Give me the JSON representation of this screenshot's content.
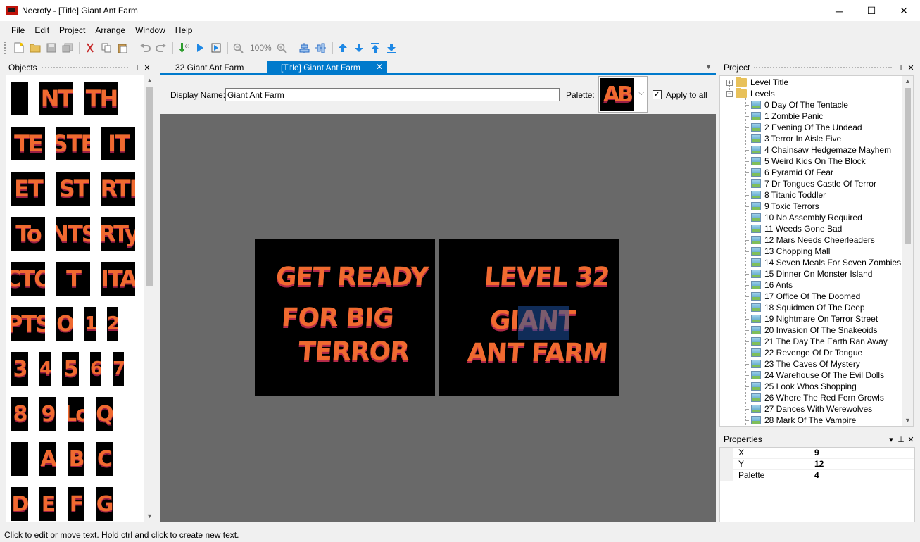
{
  "window": {
    "title": "Necrofy - [Title] Giant Ant Farm",
    "min": "─",
    "max": "☐",
    "close": "✕"
  },
  "menu": [
    "File",
    "Edit",
    "Project",
    "Arrange",
    "Window",
    "Help"
  ],
  "toolbar": {
    "zoom": "100%"
  },
  "objects_panel": {
    "title": "Objects",
    "pin": "📌",
    "close": "✕",
    "glyphs": [
      "",
      "NT",
      "TH",
      "TE",
      "STE",
      "IT",
      "ET",
      "ST",
      "RTI",
      "To",
      "NTS",
      "RTy",
      "CTO",
      "T",
      "ITA",
      "PTS",
      "O",
      "1",
      "2",
      "3",
      "4",
      "5",
      "6",
      "7",
      "8",
      "9",
      "Lo",
      "Q",
      "",
      "A",
      "B",
      "C",
      "D",
      "E",
      "F",
      "G"
    ]
  },
  "tabs": [
    {
      "label": "32 Giant Ant Farm",
      "active": false
    },
    {
      "label": "[Title] Giant Ant Farm",
      "active": true
    }
  ],
  "editor": {
    "display_name_label": "Display Name:",
    "display_name_value": "Giant Ant Farm",
    "palette_label": "Palette:",
    "palette_preview": "AB",
    "apply_all_label": "Apply to all",
    "apply_all_checked": true,
    "screen_left": [
      "GET  READY",
      "FOR BIG",
      "TERROR"
    ],
    "screen_right": [
      "LEVEL 32",
      "GIANT",
      "ANT  FARM"
    ]
  },
  "project_panel": {
    "title": "Project",
    "root_items": [
      "Level Title",
      "Levels"
    ],
    "levels": [
      "0 Day Of The Tentacle",
      "1 Zombie Panic",
      "2 Evening Of The Undead",
      "3 Terror In Aisle Five",
      "4 Chainsaw Hedgemaze Mayhem",
      "5 Weird Kids On The Block",
      "6 Pyramid Of Fear",
      "7 Dr Tongues Castle Of Terror",
      "8 Titanic Toddler",
      "9 Toxic Terrors",
      "10 No Assembly Required",
      "11 Weeds Gone Bad",
      "12 Mars Needs Cheerleaders",
      "13 Chopping Mall",
      "14 Seven Meals For Seven Zombies",
      "15 Dinner On Monster Island",
      "16 Ants",
      "17 Office Of The Doomed",
      "18 Squidmen Of The Deep",
      "19 Nightmare On Terror Street",
      "20 Invasion Of The Snakeoids",
      "21 The Day The Earth Ran Away",
      "22 Revenge Of Dr Tongue",
      "23 The Caves Of Mystery",
      "24 Warehouse Of The Evil Dolls",
      "25 Look Whos Shopping",
      "26 Where The Red Fern Growls",
      "27 Dances With Werewolves",
      "28 Mark Of The Vampire"
    ]
  },
  "properties": {
    "title": "Properties",
    "rows": [
      {
        "name": "X",
        "value": "9"
      },
      {
        "name": "Y",
        "value": "12"
      },
      {
        "name": "Palette",
        "value": "4"
      }
    ]
  },
  "status": "Click to edit or move text. Hold ctrl and click to create new text.",
  "colors": {
    "accent": "#007acc",
    "glyph": "#f06a30",
    "canvas": "#696969"
  }
}
